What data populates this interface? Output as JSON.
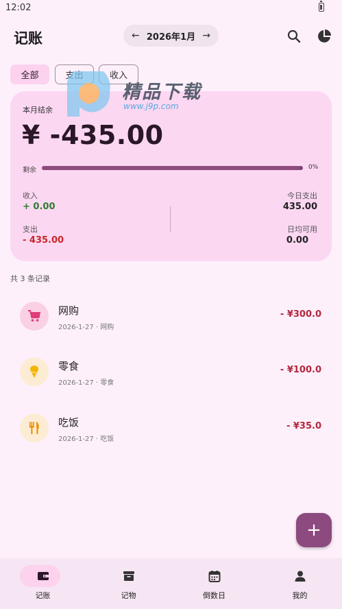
{
  "status": {
    "time": "12:02"
  },
  "header": {
    "title": "记账",
    "prev_arrow": "←",
    "month": "2026年1月",
    "next_arrow": "→"
  },
  "filters": [
    "全部",
    "支出",
    "收入"
  ],
  "summary": {
    "label": "本月结余",
    "balance": "¥ -435.00",
    "remain_label": "剩余",
    "progress_percent": 0,
    "progress_text": "0%",
    "income_label": "收入",
    "income_value": "+ 0.00",
    "expense_label": "支出",
    "expense_value": "- 435.00",
    "today_label": "今日支出",
    "today_value": "435.00",
    "daily_label": "日均可用",
    "daily_value": "0.00"
  },
  "record_count": "共 3 条记录",
  "records": [
    {
      "title": "网购",
      "sub": "2026-1-27 · 网购",
      "amount": "- ¥300.0",
      "icon": "shopping-cart-icon"
    },
    {
      "title": "零食",
      "sub": "2026-1-27 · 零食",
      "amount": "- ¥100.0",
      "icon": "ice-cream-icon"
    },
    {
      "title": "吃饭",
      "sub": "2026-1-27 · 吃饭",
      "amount": "- ¥35.0",
      "icon": "utensils-icon"
    }
  ],
  "fab": "+",
  "nav": [
    {
      "label": "记账",
      "icon": "wallet-icon"
    },
    {
      "label": "记物",
      "icon": "archive-icon"
    },
    {
      "label": "倒数日",
      "icon": "calendar-icon"
    },
    {
      "label": "我的",
      "icon": "person-icon"
    }
  ],
  "watermark": {
    "text": "精品下载",
    "url": "www.j9p.com"
  },
  "colors": {
    "accent": "#8c4a7e",
    "card": "#fcd7f2",
    "income": "#2e7d32",
    "expense": "#c62828",
    "amount": "#b3263e"
  }
}
